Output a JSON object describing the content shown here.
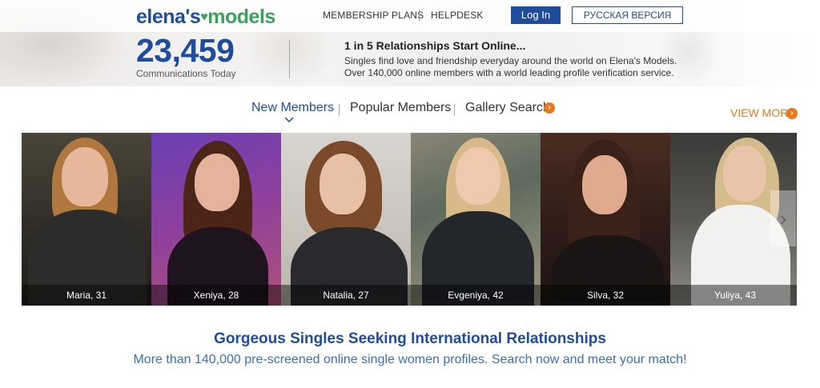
{
  "brand": {
    "logo_part1": "elena's",
    "logo_part2": "models",
    "primary_color": "#1f4d9b",
    "accent_color": "#e8781e",
    "green_color": "#3aa25d"
  },
  "header": {
    "nav": [
      {
        "label": "MEMBERSHIP PLANS"
      },
      {
        "label": "HELPDESK"
      }
    ],
    "login_label": "Log In",
    "russian_label": "РУССКАЯ ВЕРСИЯ"
  },
  "hero": {
    "count": "23,459",
    "count_label": "Communications Today",
    "tagline_title": "1 in 5 Relationships Start Online...",
    "tagline_line1": "Singles find love and friendship everyday around the world on Elena's Models.",
    "tagline_line2": "Over 140,000 online members with a world leading profile verification service."
  },
  "tabs": [
    {
      "label": "New Members",
      "active": true
    },
    {
      "label": "Popular Members",
      "active": false
    },
    {
      "label": "Gallery Search",
      "active": false
    }
  ],
  "view_more_label": "VIEW MORE",
  "members": [
    {
      "caption": "Maria, 31"
    },
    {
      "caption": "Xeniya, 28"
    },
    {
      "caption": "Natalia, 27"
    },
    {
      "caption": "Evgeniya, 42"
    },
    {
      "caption": "Silva, 32"
    },
    {
      "caption": "Yuliya, 43"
    }
  ],
  "footer": {
    "headline": "Gorgeous Singles Seeking International Relationships",
    "subline": "More than 140,000 pre-screened online single women profiles. Search now and meet your match!"
  }
}
